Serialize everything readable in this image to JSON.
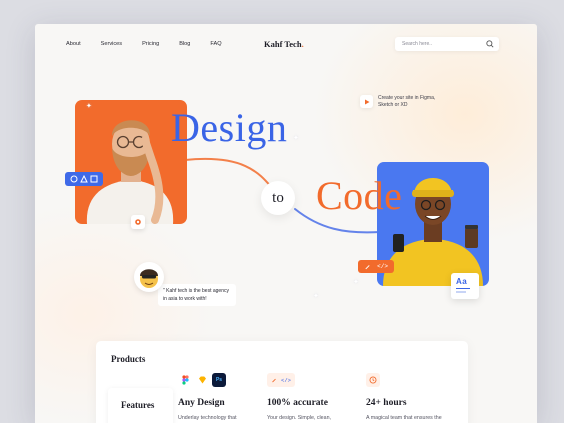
{
  "nav": {
    "items": [
      "About",
      "Services",
      "Pricing",
      "Blog",
      "FAQ"
    ]
  },
  "brand": {
    "name": "Kahf Tech",
    "dot": "."
  },
  "search": {
    "placeholder": "Search here.."
  },
  "hero": {
    "word1": "Design",
    "word2": "to",
    "word3": "Code",
    "figma_note": "Create your site in Figma, Sketch or XD",
    "typography_badge": "Aa",
    "code_badge": "</>"
  },
  "testimonial": {
    "quote": "\" Kahf tech is the best agency in asia to work with!"
  },
  "features": {
    "sidebar": [
      "Products",
      "Features"
    ],
    "columns": [
      {
        "title": "Any Design",
        "desc": "Underlay technology that translates design-to-code."
      },
      {
        "title": "100% accurate",
        "desc": "Your design. Simple, clean, semantic code. No weird stuff."
      },
      {
        "title": "24+ hours",
        "desc": "A magical team that ensures the conversion goes as planned."
      }
    ]
  },
  "colors": {
    "accent_orange": "#f26b2c",
    "accent_blue": "#3a64e6",
    "background": "#f8f7f5"
  }
}
